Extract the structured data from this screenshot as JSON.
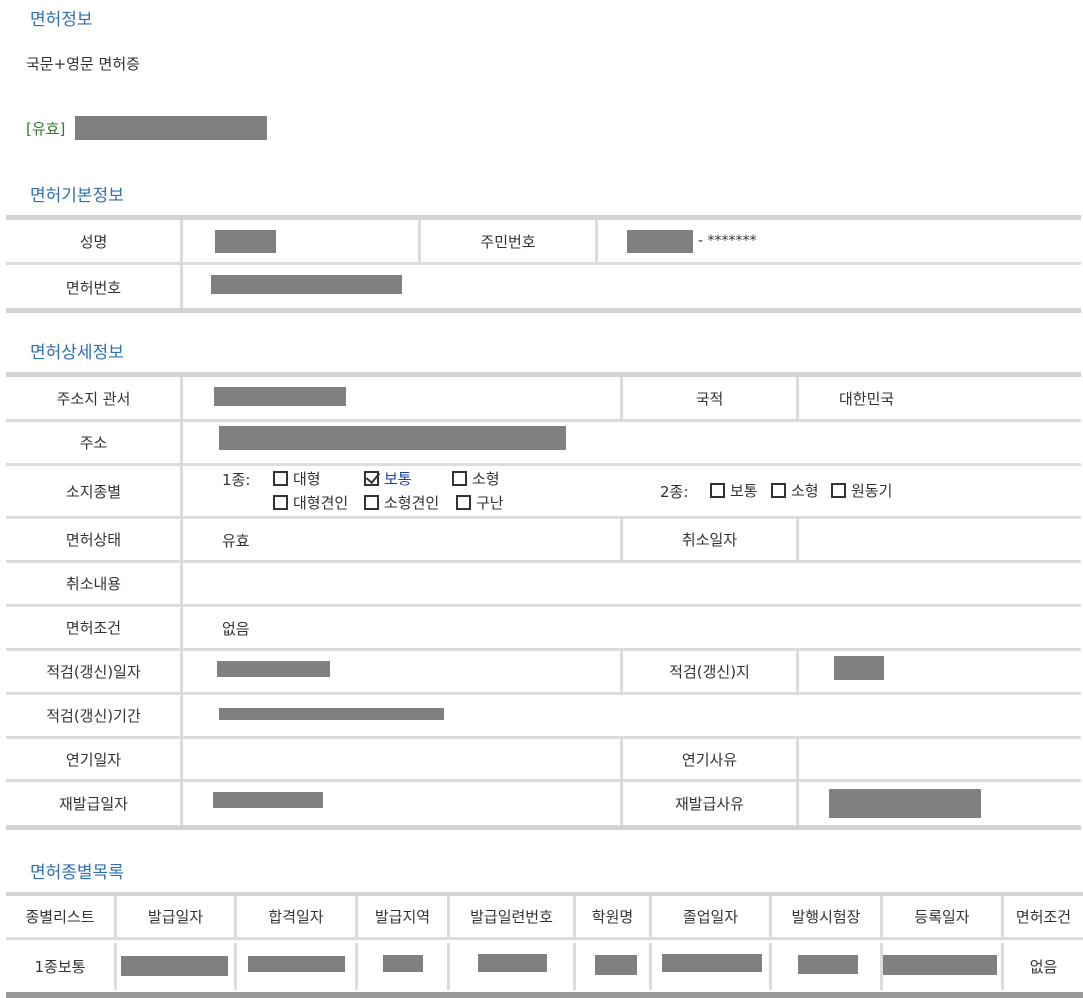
{
  "sections": {
    "license_info": "면허정보",
    "basic_info": "면허기본정보",
    "detail_info": "면허상세정보",
    "type_list": "면허종별목록"
  },
  "license": {
    "doc_type": "국문+영문 면허증",
    "status_tag": "[유효]"
  },
  "basic": {
    "name_label": "성명",
    "rrn_label": "주민번호",
    "rrn_suffix": "- *******",
    "license_no_label": "면허번호"
  },
  "detail": {
    "office_label": "주소지 관서",
    "nationality_label": "국적",
    "nationality_value": "대한민국",
    "address_label": "주소",
    "class_label": "소지종별",
    "class1_prefix": "1종:",
    "class1_options": [
      {
        "label": "대형",
        "checked": false
      },
      {
        "label": "보통",
        "checked": true
      },
      {
        "label": "소형",
        "checked": false
      },
      {
        "label": "대형견인",
        "checked": false
      },
      {
        "label": "소형견인",
        "checked": false
      },
      {
        "label": "구난",
        "checked": false
      }
    ],
    "class2_prefix": "2종:",
    "class2_options": [
      {
        "label": "보통",
        "checked": false
      },
      {
        "label": "소형",
        "checked": false
      },
      {
        "label": "원동기",
        "checked": false
      }
    ],
    "status_label": "면허상태",
    "status_value": "유효",
    "cancel_date_label": "취소일자",
    "cancel_content_label": "취소내용",
    "condition_label": "면허조건",
    "condition_value": "없음",
    "renewal_date_label": "적검(갱신)일자",
    "renewal_place_label": "적검(갱신)지",
    "renewal_period_label": "적검(갱신)기간",
    "postpone_date_label": "연기일자",
    "postpone_reason_label": "연기사유",
    "reissue_date_label": "재발급일자",
    "reissue_reason_label": "재발급사유"
  },
  "history": {
    "headers": [
      "종별리스트",
      "발급일자",
      "합격일자",
      "발급지역",
      "발급일련번호",
      "학원명",
      "졸업일자",
      "발행시험장",
      "등록일자",
      "면허조건"
    ],
    "rows": [
      {
        "type": "1종보통",
        "condition": "없음"
      }
    ]
  }
}
